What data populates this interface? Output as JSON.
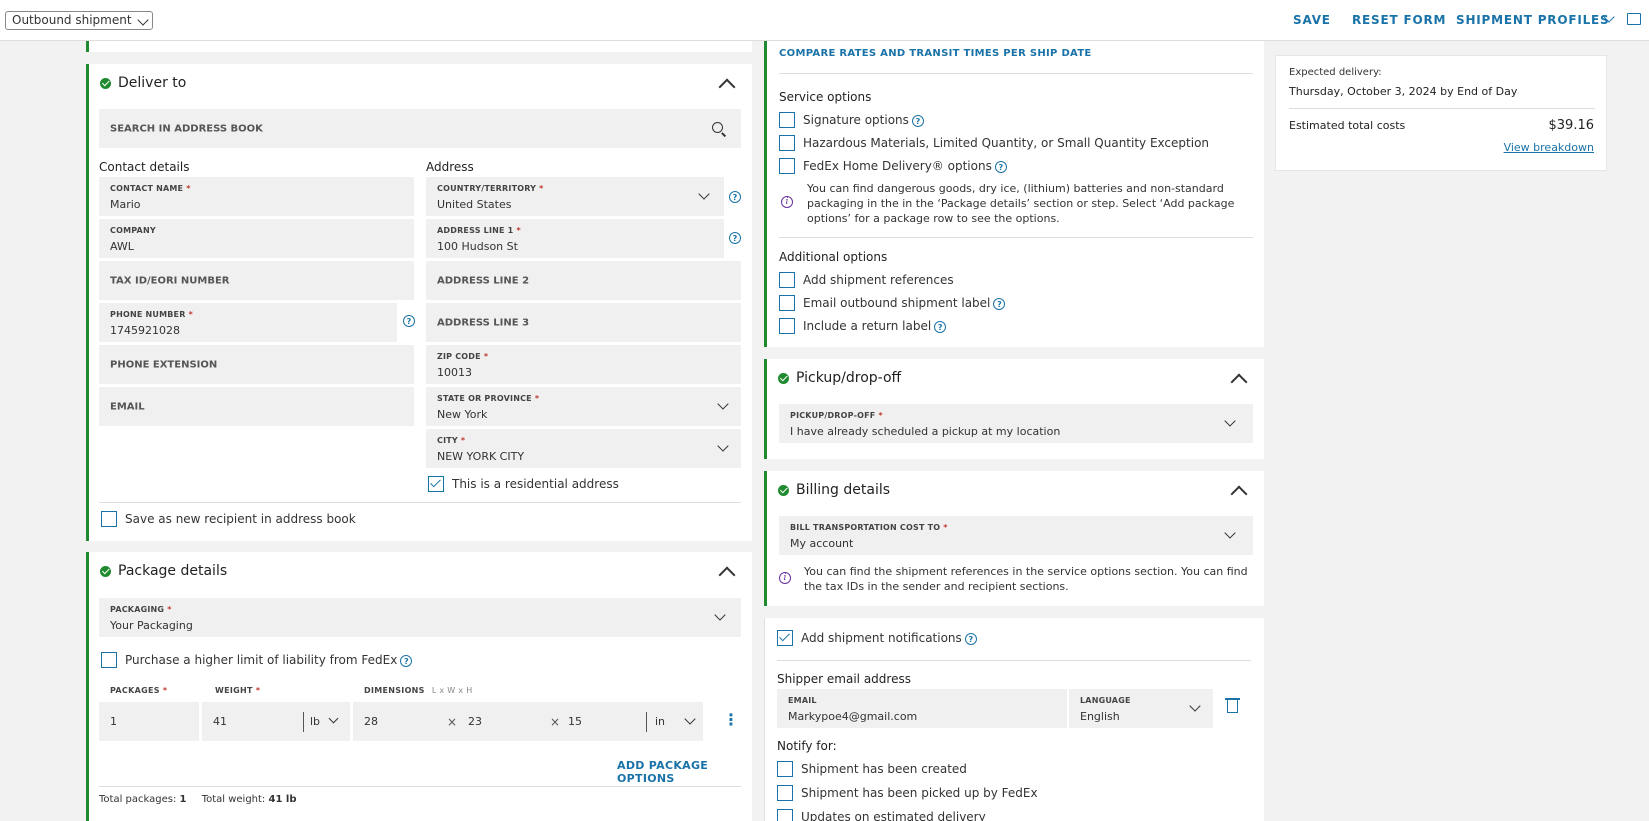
{
  "topbar": {
    "mode": "Outbound shipment",
    "save": "SAVE",
    "reset": "RESET FORM",
    "profiles": "SHIPMENT PROFILES"
  },
  "deliver_to": {
    "title": "Deliver to",
    "search": "SEARCH IN ADDRESS BOOK",
    "contact_heading": "Contact details",
    "address_heading": "Address",
    "contact_name_label": "CONTACT NAME",
    "contact_name": "Mario",
    "company_label": "COMPANY",
    "company": "AWL",
    "tax_id": "TAX ID/EORI NUMBER",
    "phone_label": "PHONE NUMBER",
    "phone": "1745921028",
    "phone_ext": "PHONE EXTENSION",
    "email": "EMAIL",
    "country_label": "COUNTRY/TERRITORY",
    "country": "United States",
    "address1_label": "ADDRESS LINE 1",
    "address1": "100 Hudson St",
    "address2": "ADDRESS LINE 2",
    "address3": "ADDRESS LINE 3",
    "zip_label": "ZIP CODE",
    "zip": "10013",
    "state_label": "STATE OR PROVINCE",
    "state": "New York",
    "city_label": "CITY",
    "city": "NEW YORK CITY",
    "residential": "This is a residential address",
    "save_recipient": "Save as new recipient in address book"
  },
  "package": {
    "title": "Package details",
    "packaging_label": "PACKAGING",
    "packaging": "Your Packaging",
    "liability": "Purchase a higher limit of liability from FedEx",
    "packages_label": "PACKAGES",
    "weight_label": "WEIGHT",
    "dimensions_label": "DIMENSIONS",
    "dimensions_hint": "L x W x H",
    "packages": "1",
    "weight": "41",
    "weight_unit": "lb",
    "dim_l": "28",
    "dim_w": "23",
    "dim_h": "15",
    "dim_unit": "in",
    "times": "×",
    "add_options": "ADD PACKAGE OPTIONS",
    "total_packages_label": "Total packages:",
    "total_packages": "1",
    "total_weight_label": "Total weight:",
    "total_weight": "41 lb"
  },
  "service": {
    "compare": "COMPARE RATES AND TRANSIT TIMES PER SHIP DATE",
    "service_heading": "Service options",
    "signature": "Signature options",
    "hazmat": "Hazardous Materials, Limited Quantity, or Small Quantity Exception",
    "home_delivery": "FedEx Home Delivery® options",
    "info": "You can find dangerous goods, dry ice, (lithium) batteries and non-standard packaging in the in the ‘Package details’ section or step. Select ‘Add package options’ for a package row to see the options.",
    "additional_heading": "Additional options",
    "references": "Add shipment references",
    "email_label": "Email outbound shipment label",
    "return_label": "Include a return label"
  },
  "pickup": {
    "title": "Pickup/drop-off",
    "label": "PICKUP/DROP-OFF",
    "value": "I have already scheduled a pickup at my location"
  },
  "billing": {
    "title": "Billing details",
    "label": "BILL TRANSPORTATION COST TO",
    "value": "My account",
    "info": "You can find the shipment references in the service options section. You can find the tax IDs in the sender and recipient sections."
  },
  "notifications": {
    "add": "Add shipment notifications",
    "shipper_email_heading": "Shipper email address",
    "email_label": "EMAIL",
    "email": "Markypoe4@gmail.com",
    "language_label": "LANGUAGE",
    "language": "English",
    "notify_for": "Notify for:",
    "created": "Shipment has been created",
    "picked_up": "Shipment has been picked up by FedEx",
    "estimated": "Updates on estimated delivery"
  },
  "summary": {
    "expected_label": "Expected delivery:",
    "expected": "Thursday, October 3, 2024 by End of Day",
    "total_label": "Estimated total costs",
    "total": "$39.16",
    "breakdown": "View breakdown"
  },
  "colors": {
    "accent": "#1a73a8",
    "success": "#1f8a2e",
    "info": "#6b2fa0"
  }
}
